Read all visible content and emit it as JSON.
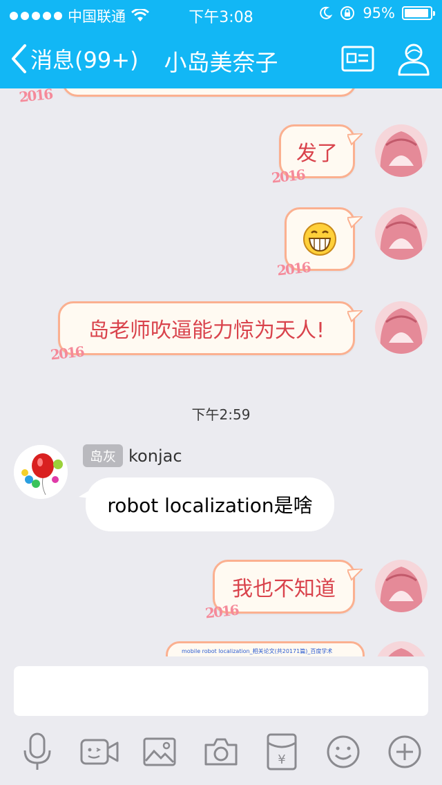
{
  "status_bar": {
    "carrier": "中国联通",
    "time": "下午3:08",
    "battery": "95%",
    "battery_level": 0.95
  },
  "nav": {
    "back_label": "消息(99+)",
    "title": "小岛美奈子"
  },
  "messages": {
    "m1": {
      "text": "发了",
      "deco": "2016"
    },
    "m2": {
      "deco": "2016"
    },
    "m3": {
      "text": "岛老师吹逼能力惊为天人!",
      "deco": "2016"
    },
    "timestamp": "下午2:59",
    "m4": {
      "sender_tag": "岛灰",
      "sender": "konjac",
      "text": "robot localization是啥"
    },
    "m5": {
      "text": "我也不知道",
      "deco": "2016"
    },
    "m6": {
      "text": "mobile robot localization_相关论文(共20171篇)_百度学术"
    }
  },
  "input": {
    "placeholder": ""
  },
  "colors": {
    "header": "#12b7f5",
    "bubble_border": "#fbb090",
    "bubble_text": "#d9434c",
    "background": "#ebebf0",
    "icon": "#8a8a8f"
  },
  "icons": {
    "toolbar": [
      "microphone-icon",
      "video-call-icon",
      "image-icon",
      "camera-icon",
      "red-packet-icon",
      "emoji-icon",
      "plus-icon"
    ]
  }
}
